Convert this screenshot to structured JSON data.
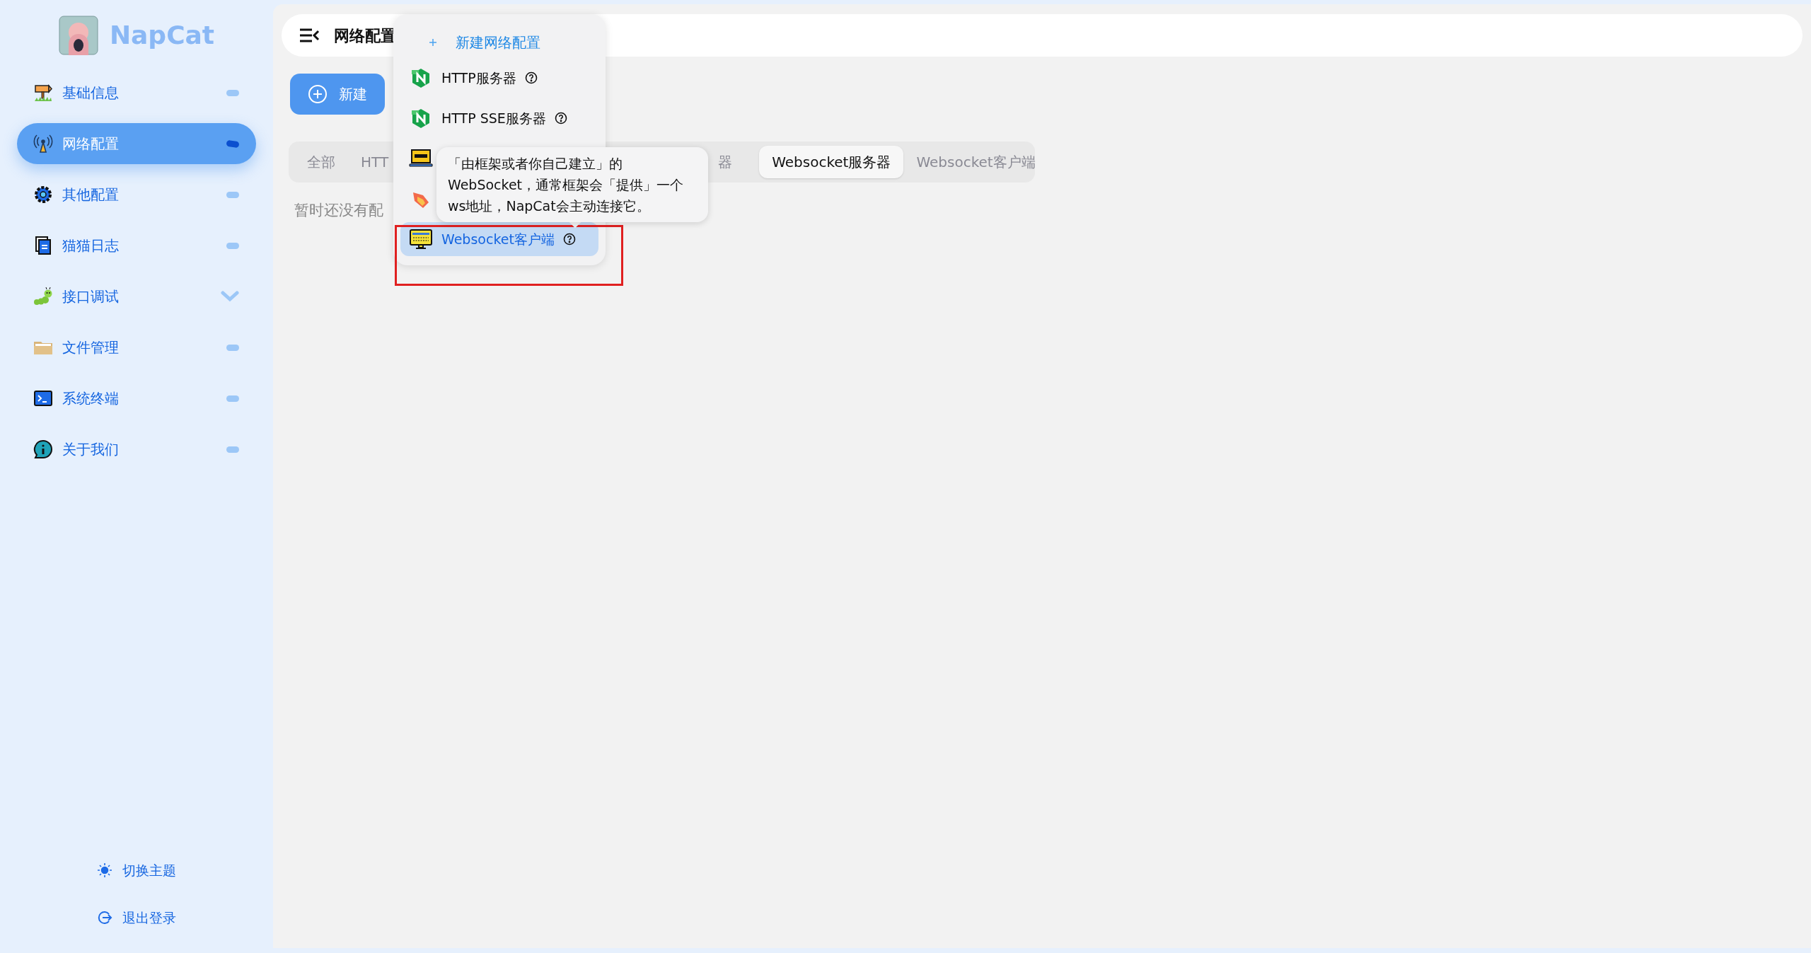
{
  "brand": {
    "name": "NapCat"
  },
  "sidebar": {
    "items": [
      {
        "label": "基础信息",
        "kind": "signpost",
        "expandable": false,
        "selected": false
      },
      {
        "label": "网络配置",
        "kind": "antenna",
        "expandable": false,
        "selected": true
      },
      {
        "label": "其他配置",
        "kind": "gear",
        "expandable": false,
        "selected": false
      },
      {
        "label": "猫猫日志",
        "kind": "document",
        "expandable": false,
        "selected": false
      },
      {
        "label": "接口调试",
        "kind": "caterpillar",
        "expandable": true,
        "selected": false
      },
      {
        "label": "文件管理",
        "kind": "folder",
        "expandable": false,
        "selected": false
      },
      {
        "label": "系统终端",
        "kind": "terminal",
        "expandable": false,
        "selected": false
      },
      {
        "label": "关于我们",
        "kind": "info",
        "expandable": false,
        "selected": false
      }
    ],
    "footer": [
      {
        "label": "切换主题",
        "kind": "sun"
      },
      {
        "label": "退出登录",
        "kind": "logout"
      }
    ]
  },
  "header": {
    "title": "网络配置"
  },
  "new_button": {
    "label": "新建"
  },
  "tabs": [
    {
      "label": "全部",
      "selected": false
    },
    {
      "label": "HTT",
      "selected": false
    },
    {
      "label": "器",
      "selected": false
    },
    {
      "label": "Websocket服务器",
      "selected": true
    },
    {
      "label": "Websocket客户端",
      "selected": false
    }
  ],
  "empty_text": "暂时还没有配",
  "menu": {
    "title": "新建网络配置",
    "items": [
      {
        "kind": "nginx",
        "label": "HTTP服务器",
        "help": true,
        "selected": false
      },
      {
        "kind": "nginx",
        "label": "HTTP SSE服务器",
        "help": true,
        "selected": false
      },
      {
        "kind": "laptop",
        "selected": false
      },
      {
        "kind": "fire",
        "selected": false
      },
      {
        "kind": "monitor",
        "label": "Websocket客户端",
        "help": true,
        "selected": true
      }
    ]
  },
  "tooltip": {
    "text": "「由框架或者你自己建立」的WebSocket，通常框架会「提供」一个ws地址，NapCat会主动连接它。"
  }
}
